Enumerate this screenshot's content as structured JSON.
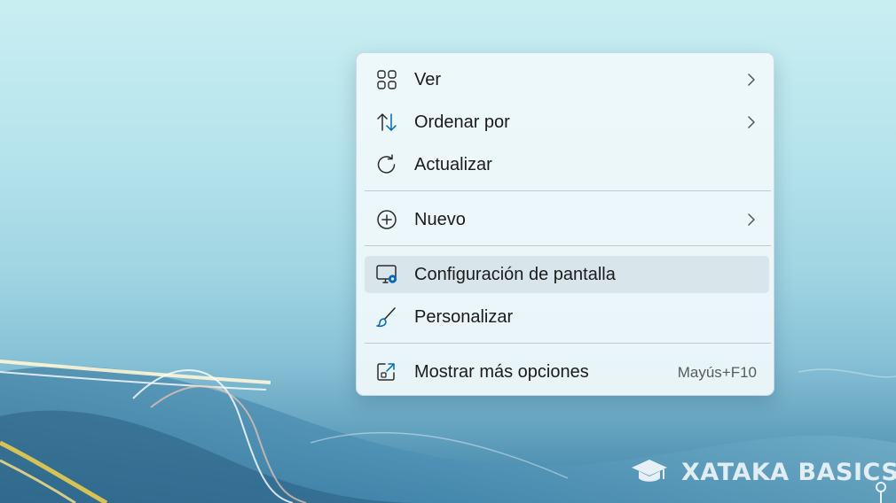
{
  "context_menu": {
    "items": [
      {
        "label": "Ver",
        "icon": "grid-icon",
        "has_submenu": true
      },
      {
        "label": "Ordenar por",
        "icon": "sort-arrows-icon",
        "has_submenu": true
      },
      {
        "label": "Actualizar",
        "icon": "refresh-icon",
        "has_submenu": false
      },
      {
        "label": "Nuevo",
        "icon": "plus-circle-icon",
        "has_submenu": true
      },
      {
        "label": "Configuración de pantalla",
        "icon": "display-settings-icon",
        "has_submenu": false,
        "hovered": true
      },
      {
        "label": "Personalizar",
        "icon": "brush-icon",
        "has_submenu": false
      },
      {
        "label": "Mostrar más opciones",
        "icon": "open-external-icon",
        "has_submenu": false,
        "shortcut": "Mayús+F10"
      }
    ]
  },
  "watermark": {
    "text": "XATAKA BASICS",
    "icon": "graduation-cap-icon"
  },
  "colors": {
    "accent": "#0067c0",
    "menu_background": "#f0f9fb",
    "hover": "#d2e0e6"
  }
}
